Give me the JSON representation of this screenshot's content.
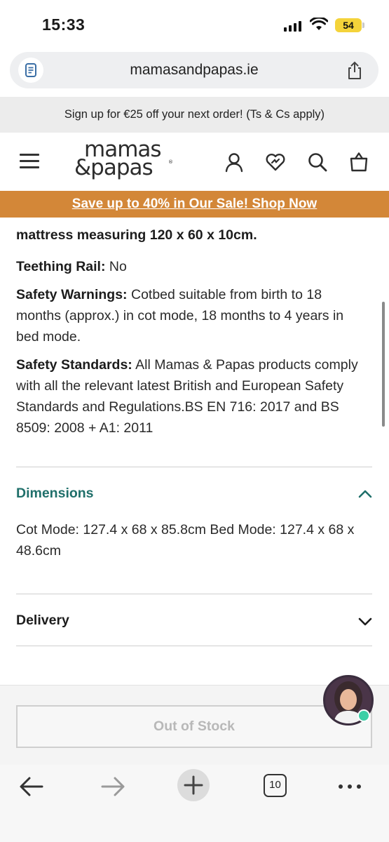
{
  "status_bar": {
    "time": "15:33",
    "battery": "54"
  },
  "browser": {
    "url": "mamasandpapas.ie",
    "tab_count": "10"
  },
  "promo": {
    "text": "Sign up for €25 off your next order! (Ts & Cs apply)"
  },
  "header": {
    "logo_line1": "mamas",
    "logo_line2": "&papas",
    "logo_mark": "®"
  },
  "sale_banner": {
    "text": "Save up to 40% in Our Sale! Shop Now"
  },
  "specs": {
    "mattress_text": "mattress measuring 120 x 60 x 10cm.",
    "teething_label": "Teething Rail:",
    "teething_value": " No",
    "warnings_label": "Safety Warnings:",
    "warnings_value": " Cotbed suitable from birth to 18 months (approx.) in cot mode, 18 months to 4 years in bed mode.",
    "standards_label": "Safety Standards:",
    "standards_value": " All Mamas & Papas products comply with all the relevant latest British and European Safety Standards and Regulations.BS EN 716: 2017 and BS 8509: 2008 + A1: 2011"
  },
  "dimensions": {
    "title": "Dimensions",
    "text": "Cot Mode: 127.4 x 68 x 85.8cm Bed Mode: 127.4 x 68 x 48.6cm",
    "expanded": true
  },
  "delivery": {
    "title": "Delivery",
    "expanded": false
  },
  "cta": {
    "label": "Out of Stock"
  },
  "colors": {
    "brand_teal": "#1f6f6a",
    "sale_orange": "#d38738",
    "online_dot": "#3ccfa6"
  },
  "icons": [
    "site-settings-icon",
    "share-icon",
    "menu-icon",
    "account-icon",
    "wishlist-icon",
    "search-icon",
    "bag-icon",
    "chevron-up-icon",
    "chevron-down-icon",
    "back-icon",
    "forward-icon",
    "new-tab-icon",
    "tabs-icon",
    "more-icon",
    "chat-avatar-icon"
  ]
}
